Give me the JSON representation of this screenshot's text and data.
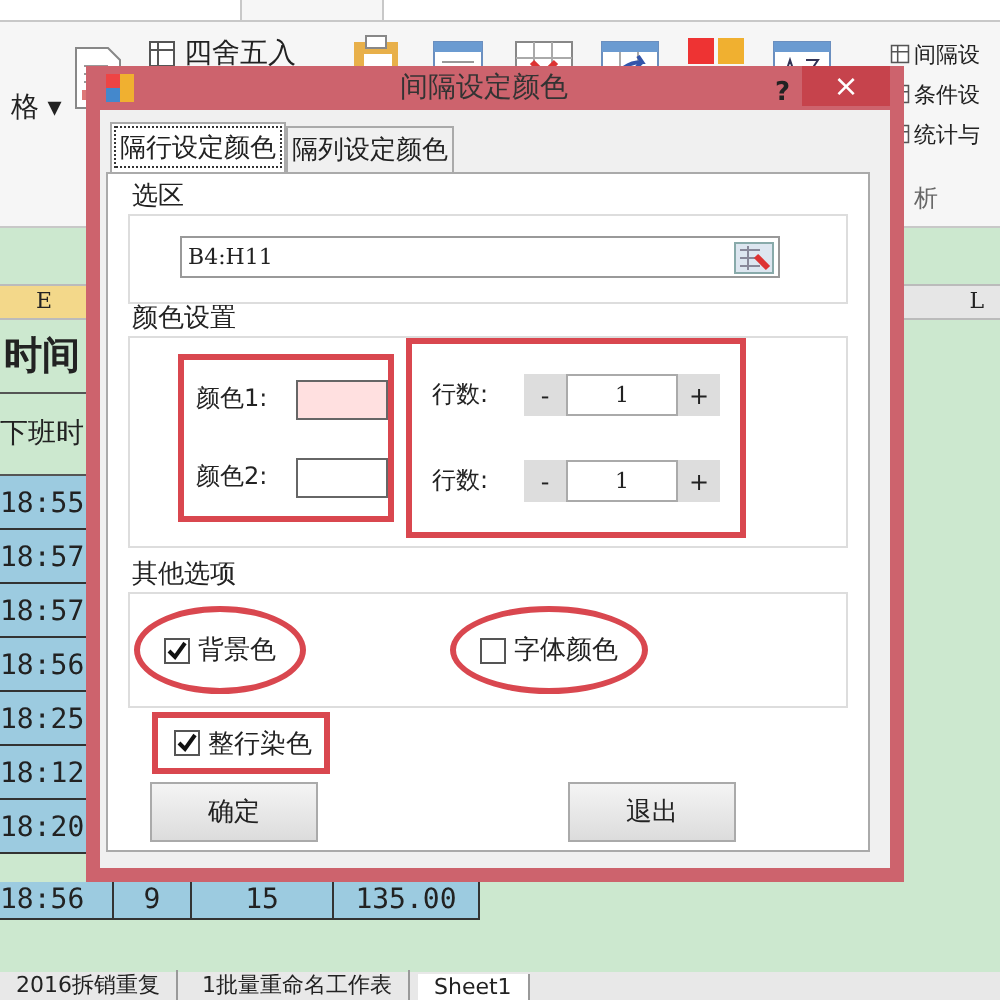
{
  "ribbon": {
    "items": [
      {
        "label": "格",
        "caret": "▾",
        "kind": "dropdown"
      },
      {
        "label": "四舍五入",
        "kind": "small"
      }
    ],
    "side_items": [
      "间隔设",
      "条件设",
      "统计与"
    ],
    "group_label": "析"
  },
  "sheet": {
    "columns": [
      "E",
      "L"
    ],
    "title": "时间",
    "header": "下班时",
    "times": [
      "18:55",
      "18:57",
      "18:57",
      "18:56",
      "18:25",
      "18:12",
      "18:20"
    ],
    "last_row": [
      "18:56",
      "9",
      "15",
      "135.00"
    ]
  },
  "sheet_tabs": [
    {
      "label": "2016拆销重复",
      "selected": false
    },
    {
      "label": "1批量重命名工作表",
      "selected": false
    },
    {
      "label": "Sheet1",
      "selected": true
    }
  ],
  "dialog": {
    "title": "间隔设定颜色",
    "help": "?",
    "close": "×",
    "tabs": [
      {
        "label": "隔行设定颜色",
        "selected": true
      },
      {
        "label": "隔列设定颜色",
        "selected": false
      }
    ],
    "range_group": {
      "label": "选区",
      "value": "B4:H11"
    },
    "color_group": {
      "label": "颜色设置",
      "colors": [
        {
          "label": "颜色1:",
          "color": "#ffe0e0"
        },
        {
          "label": "颜色2:",
          "color": "#ffffff"
        }
      ],
      "colors_highlighted": true,
      "counts": [
        {
          "label": "行数:",
          "minus": "-",
          "value": "1",
          "plus": "+"
        },
        {
          "label": "行数:",
          "minus": "-",
          "value": "1",
          "plus": "+"
        }
      ],
      "counts_highlighted": true
    },
    "other_group": {
      "label": "其他选项",
      "options": [
        {
          "label": "背景色",
          "checked": true,
          "circled": true
        },
        {
          "label": "字体颜色",
          "checked": false,
          "circled": true
        }
      ]
    },
    "whole_row": {
      "label": "整行染色",
      "checked": true,
      "highlighted": true
    },
    "buttons": [
      "确定",
      "退出"
    ]
  }
}
